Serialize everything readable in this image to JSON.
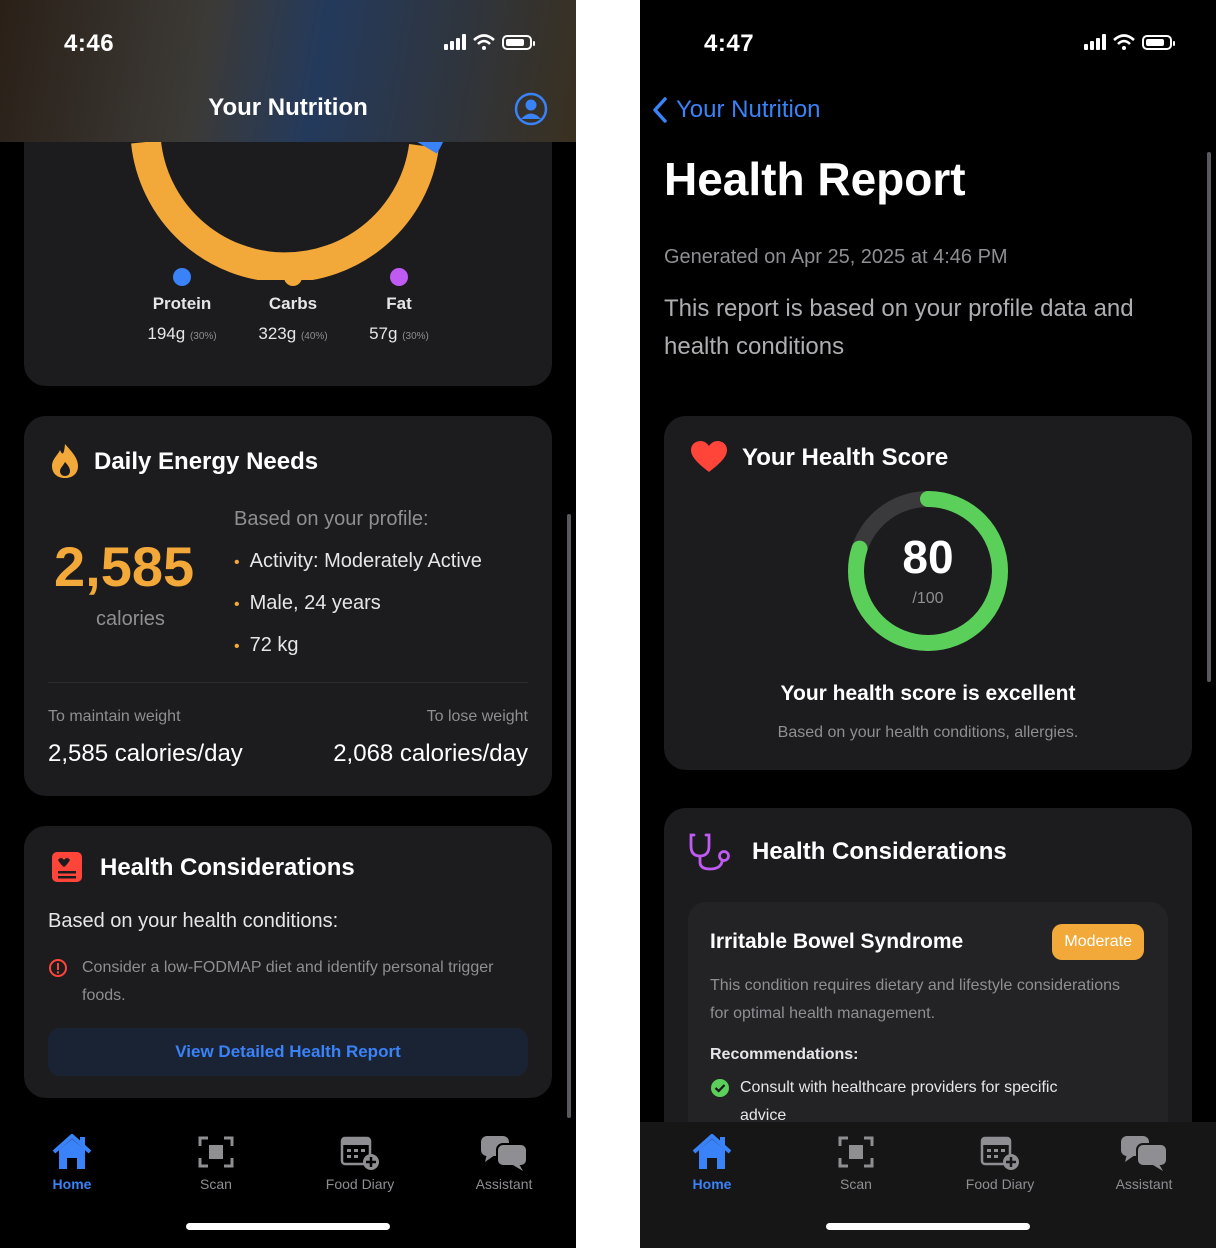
{
  "left": {
    "status": {
      "time": "4:46"
    },
    "header": {
      "title": "Your Nutrition"
    },
    "macros": [
      {
        "name": "Protein",
        "grams": "194g",
        "pct": "(30%)",
        "color": "#3a82f7"
      },
      {
        "name": "Carbs",
        "grams": "323g",
        "pct": "(40%)",
        "color": "#f3a83a"
      },
      {
        "name": "Fat",
        "grams": "57g",
        "pct": "(30%)",
        "color": "#bf5af2"
      }
    ],
    "energy": {
      "title": "Daily Energy Needs",
      "calories": "2,585",
      "unit": "calories",
      "profile_label": "Based on your profile:",
      "bullets": [
        "Activity: Moderately Active",
        "Male, 24 years",
        "72 kg"
      ],
      "maintain_label": "To maintain weight",
      "maintain_value": "2,585 calories/day",
      "lose_label": "To lose weight",
      "lose_value": "2,068 calories/day"
    },
    "health": {
      "title": "Health Considerations",
      "subtitle": "Based on your health conditions:",
      "tip": "Consider a low-FODMAP diet and identify personal trigger foods.",
      "button": "View Detailed Health Report"
    }
  },
  "right": {
    "status": {
      "time": "4:47"
    },
    "back_label": "Your Nutrition",
    "title": "Health Report",
    "generated": "Generated on Apr 25, 2025 at 4:46 PM",
    "description": "This report is based on your profile data and health conditions",
    "score": {
      "title": "Your Health Score",
      "value": "80",
      "max": "/100",
      "fraction": 0.8,
      "message": "Your health score is excellent",
      "basis": "Based on your health conditions, allergies."
    },
    "health": {
      "title": "Health Considerations",
      "condition": "Irritable Bowel Syndrome",
      "severity": "Moderate",
      "description": "This condition requires dietary and lifestyle considerations for optimal health management.",
      "rec_title": "Recommendations:",
      "rec_item": "Consult with healthcare providers for specific advice"
    }
  },
  "tabs": [
    "Home",
    "Scan",
    "Food Diary",
    "Assistant"
  ],
  "colors": {
    "accent": "#3a82f7",
    "orange": "#f3a83a",
    "green": "#5ad05a",
    "purple": "#bf5af2",
    "red": "#ff453a"
  }
}
